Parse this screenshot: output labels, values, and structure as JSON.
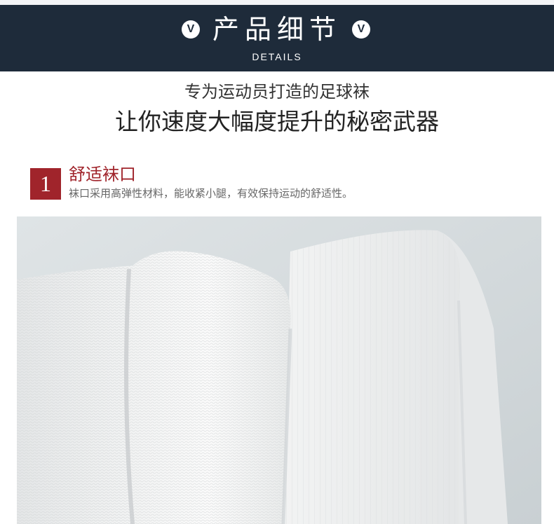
{
  "header": {
    "title": "产品细节",
    "subtitle": "DETAILS",
    "badge_left": "V",
    "badge_right": "V"
  },
  "tagline": {
    "line1": "专为运动员打造的足球袜",
    "line2": "让你速度大幅度提升的秘密武器"
  },
  "feature": {
    "number": "1",
    "title": "舒适袜口",
    "description": "袜口采用高弹性材料，能收紧小腿，有效保持运动的舒适性。"
  },
  "colors": {
    "banner_bg": "#1e2b3a",
    "accent_red": "#a0242b"
  }
}
